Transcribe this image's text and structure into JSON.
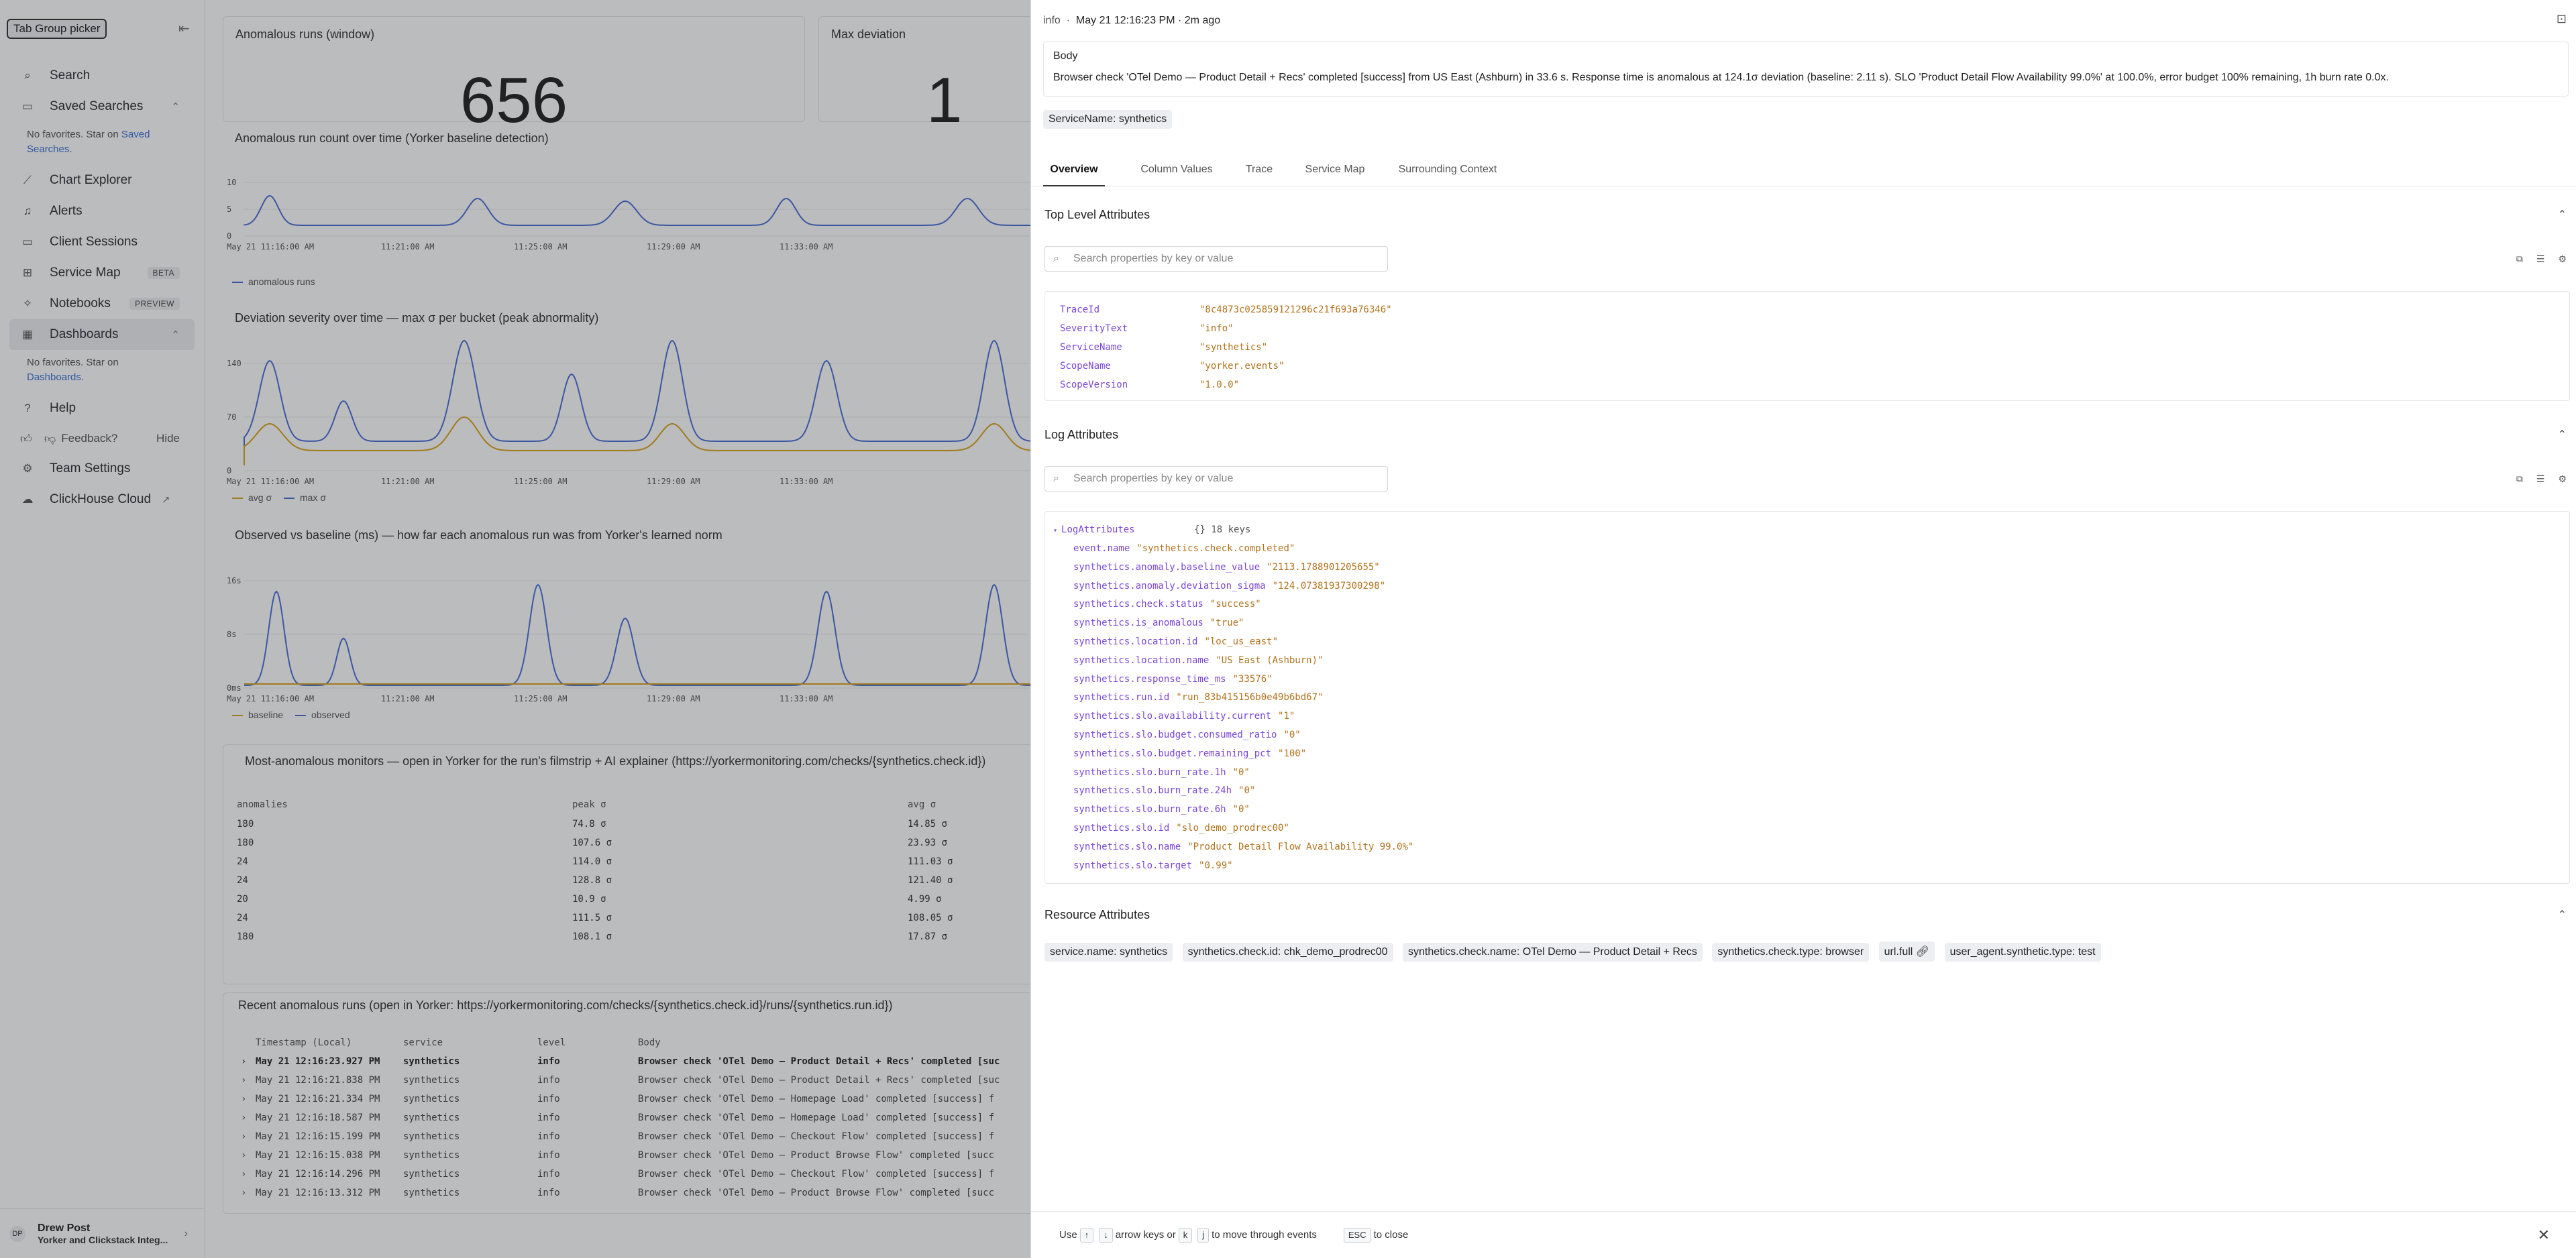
{
  "sidebar": {
    "tooltip": "Tab Group picker",
    "collapse_icon": "chevron-collapse-icon",
    "items": [
      {
        "key": "search",
        "label": "Search",
        "icon": "search-icon"
      },
      {
        "key": "saved",
        "label": "Saved Searches",
        "icon": "bookmark-icon"
      },
      {
        "key": "chart",
        "label": "Chart Explorer",
        "icon": "chart-icon"
      },
      {
        "key": "alerts",
        "label": "Alerts",
        "icon": "bell-icon"
      },
      {
        "key": "sessions",
        "label": "Client Sessions",
        "icon": "monitor-icon"
      },
      {
        "key": "servicemap",
        "label": "Service Map",
        "icon": "map-icon",
        "badge": "BETA"
      },
      {
        "key": "notebooks",
        "label": "Notebooks",
        "icon": "notebook-icon",
        "badge": "PREVIEW"
      },
      {
        "key": "dashboards",
        "label": "Dashboards",
        "icon": "dashboard-icon"
      },
      {
        "key": "help",
        "label": "Help",
        "icon": "help-icon"
      },
      {
        "key": "team",
        "label": "Team Settings",
        "icon": "gear-icon"
      },
      {
        "key": "cloud",
        "label": "ClickHouse Cloud",
        "icon": "cloud-icon"
      }
    ],
    "saved_note_a": "No favorites. Star on ",
    "saved_note_link": "Saved Searches",
    "dash_note_a": "No favorites. Star on",
    "dash_note_link": "Dashboards",
    "feedback": "Feedback?",
    "hide": "Hide",
    "user": {
      "initials": "DP",
      "name": "Drew Post",
      "org": "Yorker and Clickstack Integ..."
    }
  },
  "dashboard": {
    "tile1_title": "Anomalous runs (window)",
    "tile1_value": "656",
    "tile2_title": "Max deviation",
    "tile2_value": "1",
    "chart1": {
      "title": "Anomalous run count over time (Yorker baseline detection)",
      "yticks": [
        "10",
        "5",
        "0"
      ],
      "xticks": [
        "May 21 11:16:00 AM",
        "11:21:00 AM",
        "11:25:00 AM",
        "11:29:00 AM",
        "11:33:00 AM"
      ],
      "legend": "anomalous runs",
      "color": "#4a6fd8"
    },
    "chart2": {
      "title": "Deviation severity over time — max σ per bucket (peak abnormality)",
      "yticks": [
        "140",
        "70",
        "0"
      ],
      "xticks": [
        "May 21 11:16:00 AM",
        "11:21:00 AM",
        "11:25:00 AM",
        "11:29:00 AM",
        "11:33:00 AM"
      ],
      "legend_a": "avg σ",
      "legend_b": "max σ",
      "color_a": "#d8a21c",
      "color_b": "#4a6fd8"
    },
    "chart3": {
      "title": "Observed vs baseline (ms) — how far each anomalous run was from Yorker's learned norm",
      "yticks": [
        "16s",
        "8s",
        "0ms"
      ],
      "xticks": [
        "May 21 11:16:00 AM",
        "11:21:00 AM",
        "11:25:00 AM",
        "11:29:00 AM",
        "11:33:00 AM"
      ],
      "legend_a": "baseline",
      "legend_b": "observed",
      "color_a": "#d8a21c",
      "color_b": "#4a6fd8"
    },
    "table": {
      "title": "Most-anomalous monitors — open in Yorker for the run's filmstrip + AI explainer (https://yorkermonitoring.com/checks/{synthetics.check.id})",
      "headers": [
        "anomalies",
        "peak σ",
        "avg σ"
      ],
      "rows": [
        [
          "180",
          "74.8 σ",
          "14.85 σ"
        ],
        [
          "180",
          "107.6 σ",
          "23.93 σ"
        ],
        [
          "24",
          "114.0 σ",
          "111.03 σ"
        ],
        [
          "24",
          "128.8 σ",
          "121.40 σ"
        ],
        [
          "20",
          "10.9 σ",
          "4.99 σ"
        ],
        [
          "24",
          "111.5 σ",
          "108.05 σ"
        ],
        [
          "180",
          "108.1 σ",
          "17.87 σ"
        ]
      ]
    },
    "recent": {
      "title": "Recent anomalous runs (open in Yorker: https://yorkermonitoring.com/checks/{synthetics.check.id}/runs/{synthetics.run.id})",
      "headers": [
        "Timestamp (Local)",
        "service",
        "level",
        "Body"
      ],
      "rows": [
        [
          "May 21 12:16:23.927 PM",
          "synthetics",
          "info",
          "Browser check 'OTel Demo — Product Detail + Recs' completed [suc"
        ],
        [
          "May 21 12:16:21.838 PM",
          "synthetics",
          "info",
          "Browser check 'OTel Demo — Product Detail + Recs' completed [suc"
        ],
        [
          "May 21 12:16:21.334 PM",
          "synthetics",
          "info",
          "Browser check 'OTel Demo — Homepage Load' completed [success] f"
        ],
        [
          "May 21 12:16:18.587 PM",
          "synthetics",
          "info",
          "Browser check 'OTel Demo — Homepage Load' completed [success] f"
        ],
        [
          "May 21 12:16:15.199 PM",
          "synthetics",
          "info",
          "Browser check 'OTel Demo — Checkout Flow' completed [success] f"
        ],
        [
          "May 21 12:16:15.038 PM",
          "synthetics",
          "info",
          "Browser check 'OTel Demo — Product Browse Flow' completed [succ"
        ],
        [
          "May 21 12:16:14.296 PM",
          "synthetics",
          "info",
          "Browser check 'OTel Demo — Checkout Flow' completed [success] f"
        ],
        [
          "May 21 12:16:13.312 PM",
          "synthetics",
          "info",
          "Browser check 'OTel Demo — Product Browse Flow' completed [succ"
        ]
      ]
    }
  },
  "drawer": {
    "level": "info",
    "separator": "·",
    "timestamp": "May 21 12:16:23 PM · 2m ago",
    "body_title": "Body",
    "body_text": "Browser check 'OTel Demo — Product Detail + Recs' completed [success] from US East (Ashburn) in 33.6 s. Response time is anomalous at 124.1σ deviation (baseline: 2.11 s). SLO 'Product Detail Flow Availability 99.0%' at 100.0%, error budget 100% remaining, 1h burn rate 0.0x.",
    "service_chip": "ServiceName: synthetics",
    "tabs": [
      "Overview",
      "Column Values",
      "Trace",
      "Service Map",
      "Surrounding Context"
    ],
    "top_title": "Top Level Attributes",
    "search_placeholder": "Search properties by key or value",
    "top_attrs": [
      {
        "k": "TraceId",
        "v": "\"8c4873c025859121296c21f693a76346\""
      },
      {
        "k": "SeverityText",
        "v": "\"info\""
      },
      {
        "k": "ServiceName",
        "v": "\"synthetics\""
      },
      {
        "k": "ScopeName",
        "v": "\"yorker.events\""
      },
      {
        "k": "ScopeVersion",
        "v": "\"1.0.0\""
      }
    ],
    "log_title": "Log Attributes",
    "log_root": "LogAttributes",
    "log_root_meta": "{} 18 keys",
    "log_attrs": [
      {
        "k": "event.name",
        "v": "\"synthetics.check.completed\""
      },
      {
        "k": "synthetics.anomaly.baseline_value",
        "v": "\"2113.1788901205655\""
      },
      {
        "k": "synthetics.anomaly.deviation_sigma",
        "v": "\"124.07381937300298\""
      },
      {
        "k": "synthetics.check.status",
        "v": "\"success\""
      },
      {
        "k": "synthetics.is_anomalous",
        "v": "\"true\""
      },
      {
        "k": "synthetics.location.id",
        "v": "\"loc_us_east\""
      },
      {
        "k": "synthetics.location.name",
        "v": "\"US East (Ashburn)\""
      },
      {
        "k": "synthetics.response_time_ms",
        "v": "\"33576\""
      },
      {
        "k": "synthetics.run.id",
        "v": "\"run_83b415156b0e49b6bd67\""
      },
      {
        "k": "synthetics.slo.availability.current",
        "v": "\"1\""
      },
      {
        "k": "synthetics.slo.budget.consumed_ratio",
        "v": "\"0\""
      },
      {
        "k": "synthetics.slo.budget.remaining_pct",
        "v": "\"100\""
      },
      {
        "k": "synthetics.slo.burn_rate.1h",
        "v": "\"0\""
      },
      {
        "k": "synthetics.slo.burn_rate.24h",
        "v": "\"0\""
      },
      {
        "k": "synthetics.slo.burn_rate.6h",
        "v": "\"0\""
      },
      {
        "k": "synthetics.slo.id",
        "v": "\"slo_demo_prodrec00\""
      },
      {
        "k": "synthetics.slo.name",
        "v": "\"Product Detail Flow Availability 99.0%\""
      },
      {
        "k": "synthetics.slo.target",
        "v": "\"0.99\""
      }
    ],
    "res_title": "Resource Attributes",
    "res_chips": [
      "service.name: synthetics",
      "synthetics.check.id: chk_demo_prodrec00",
      "synthetics.check.name: OTel Demo — Product Detail + Recs",
      "synthetics.check.type: browser",
      "url.full",
      "user_agent.synthetic.type: test"
    ],
    "footer": {
      "use": "Use",
      "up": "↑",
      "down": "↓",
      "arrow_text": "arrow keys or",
      "k": "k",
      "j": "j",
      "move_text": "to move through events",
      "esc": "ESC",
      "close_text": "to close"
    }
  }
}
